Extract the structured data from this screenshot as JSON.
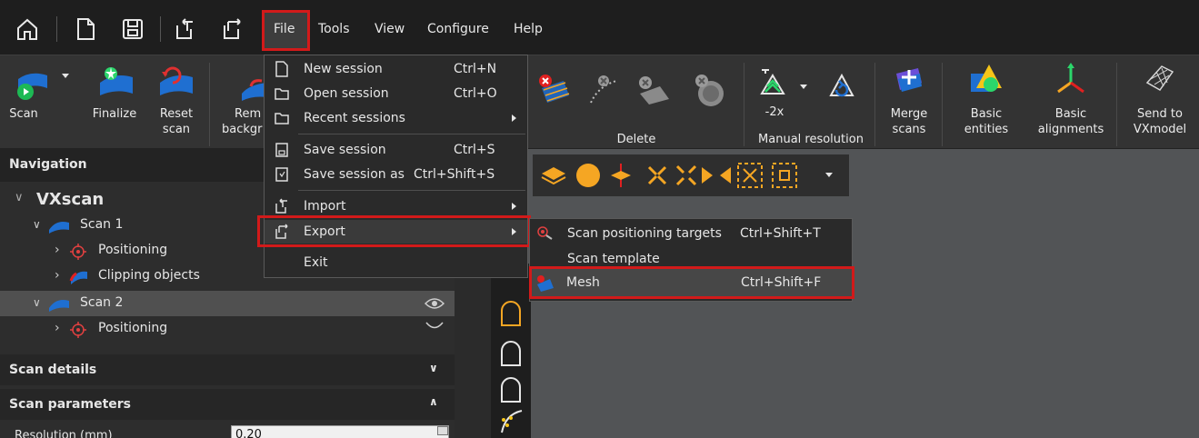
{
  "menubar": {
    "file": "File",
    "tools": "Tools",
    "view": "View",
    "configure": "Configure",
    "help": "Help"
  },
  "quick_access": [
    "home-icon",
    "new-file-icon",
    "save-icon",
    "import-icon",
    "export-icon"
  ],
  "ribbon": {
    "scan": "Scan",
    "finalize": "Finalize",
    "reset_scan_1": "Reset",
    "reset_scan_2": "scan",
    "remove_bg_1": "Rem",
    "remove_bg_2": "backgr",
    "delete_group": "Delete",
    "resolution_value": "-2x",
    "manual_resolution": "Manual resolution",
    "merge_1": "Merge",
    "merge_2": "scans",
    "basic_entities_1": "Basic",
    "basic_entities_2": "entities",
    "basic_alignments_1": "Basic",
    "basic_alignments_2": "alignments",
    "send_to_1": "Send to",
    "send_to_2": "VXmodel"
  },
  "navigation": {
    "title": "Navigation",
    "root": "VXscan",
    "scan1": "Scan 1",
    "positioning1": "Positioning",
    "clipping": "Clipping objects",
    "scan2": "Scan 2",
    "positioning2": "Positioning"
  },
  "panels": {
    "scan_details": "Scan details",
    "scan_parameters": "Scan parameters",
    "resolution_label": "Resolution (mm)",
    "resolution_value": "0.20"
  },
  "file_menu": {
    "new_session": "New session",
    "new_session_sc": "Ctrl+N",
    "open_session": "Open session",
    "open_session_sc": "Ctrl+O",
    "recent_sessions": "Recent sessions",
    "save_session": "Save session",
    "save_session_sc": "Ctrl+S",
    "save_session_as": "Save session as",
    "save_session_as_sc": "Ctrl+Shift+S",
    "import": "Import",
    "export": "Export",
    "exit": "Exit"
  },
  "export_menu": {
    "scan_positioning_targets": "Scan positioning targets",
    "scan_positioning_targets_sc": "Ctrl+Shift+T",
    "scan_template": "Scan template",
    "mesh": "Mesh",
    "mesh_sc": "Ctrl+Shift+F"
  },
  "colors": {
    "highlight": "#d21a1a",
    "accent_blue": "#1f6fd1",
    "accent_orange": "#f5a623"
  }
}
